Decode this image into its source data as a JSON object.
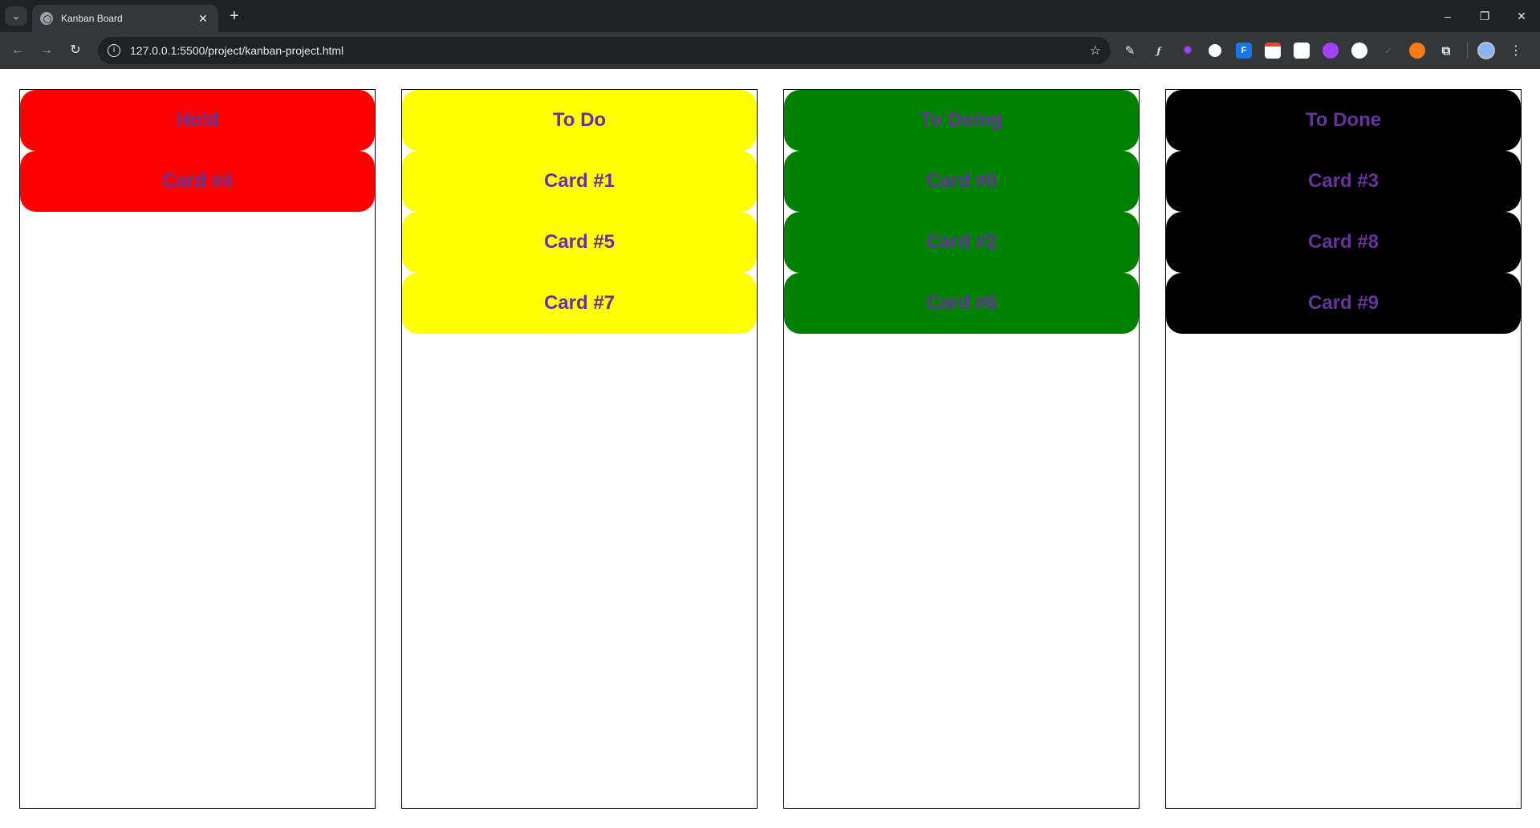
{
  "browser": {
    "tab_title": "Kanban Board",
    "tab_close": "✕",
    "new_tab": "+",
    "url": "127.0.0.1:5500/project/kanban-project.html",
    "window_controls": {
      "minimize": "–",
      "restore": "❐",
      "close": "✕"
    }
  },
  "board": {
    "text_color": "#663399",
    "columns": [
      {
        "title": "Hold",
        "color": "#ff0000",
        "cards": [
          "Card #4"
        ]
      },
      {
        "title": "To Do",
        "color": "#ffff00",
        "cards": [
          "Card #1",
          "Card #5",
          "Card #7"
        ]
      },
      {
        "title": "To Doing",
        "color": "#008000",
        "cards": [
          "Card #0",
          "Card #2",
          "Card #6"
        ]
      },
      {
        "title": "To Done",
        "color": "#000000",
        "cards": [
          "Card #3",
          "Card #8",
          "Card #9"
        ]
      }
    ]
  }
}
